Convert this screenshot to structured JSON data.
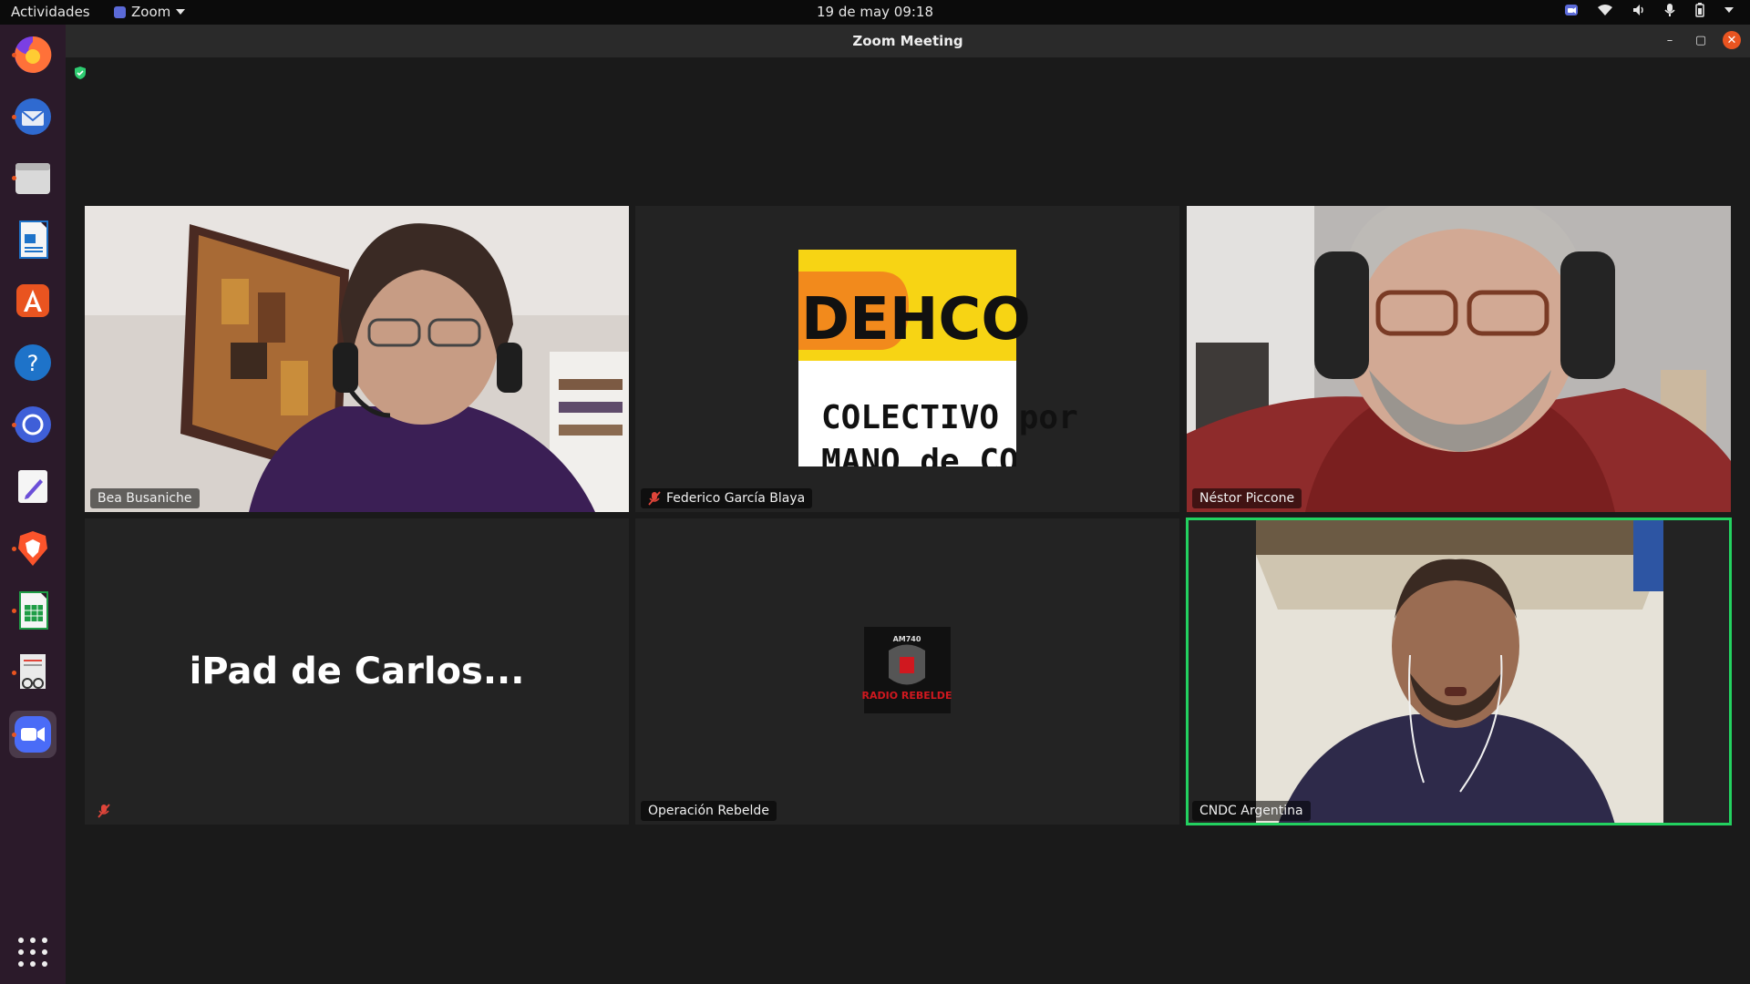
{
  "topbar": {
    "activities": "Actividades",
    "app_name": "Zoom",
    "clock": "19 de may  09:18"
  },
  "dock": {
    "items": [
      {
        "icon": "firefox-icon",
        "color": "#ff7139"
      },
      {
        "icon": "thunderbird-icon",
        "color": "#2f6ad0"
      },
      {
        "icon": "files-icon",
        "color": "#d8d8d8"
      },
      {
        "icon": "writer-icon",
        "color": "#1e73c9"
      },
      {
        "icon": "app-center-icon",
        "color": "#e95420"
      },
      {
        "icon": "help-icon",
        "color": "#1e73c9"
      },
      {
        "icon": "chromium-icon",
        "color": "#3f5fd8"
      },
      {
        "icon": "text-editor-icon",
        "color": "#f5f5f5"
      },
      {
        "icon": "brave-icon",
        "color": "#fb542b"
      },
      {
        "icon": "calc-icon",
        "color": "#1f9d46"
      },
      {
        "icon": "document-viewer-icon",
        "color": "#eaeaea"
      },
      {
        "icon": "zoom-icon",
        "color": "#4a6cf7"
      }
    ]
  },
  "window": {
    "title": "Zoom Meeting"
  },
  "participants": [
    {
      "name": "Bea Busaniche",
      "muted": false,
      "active": false,
      "kind": "video"
    },
    {
      "name": "Federico García Blaya",
      "muted": true,
      "active": false,
      "kind": "logo",
      "logo_text_top": "DEHCO",
      "logo_text_bottom": "COLECTIVO por",
      "logo_text_cut": "MANO de COMU"
    },
    {
      "name": "Néstor Piccone",
      "muted": false,
      "active": false,
      "kind": "video"
    },
    {
      "name": "",
      "display_text": "iPad de Carlos...",
      "muted": true,
      "active": false,
      "kind": "name"
    },
    {
      "name": "Operación Rebelde",
      "muted": false,
      "active": false,
      "kind": "logo",
      "logo_text_top": "AM740",
      "logo_text_bottom": "RADIO REBELDE"
    },
    {
      "name": "CNDC Argentina",
      "muted": false,
      "active": true,
      "kind": "video"
    }
  ],
  "colors": {
    "active_speaker": "#23d160",
    "muted_icon": "#e0453a",
    "shield": "#2ecc71"
  }
}
